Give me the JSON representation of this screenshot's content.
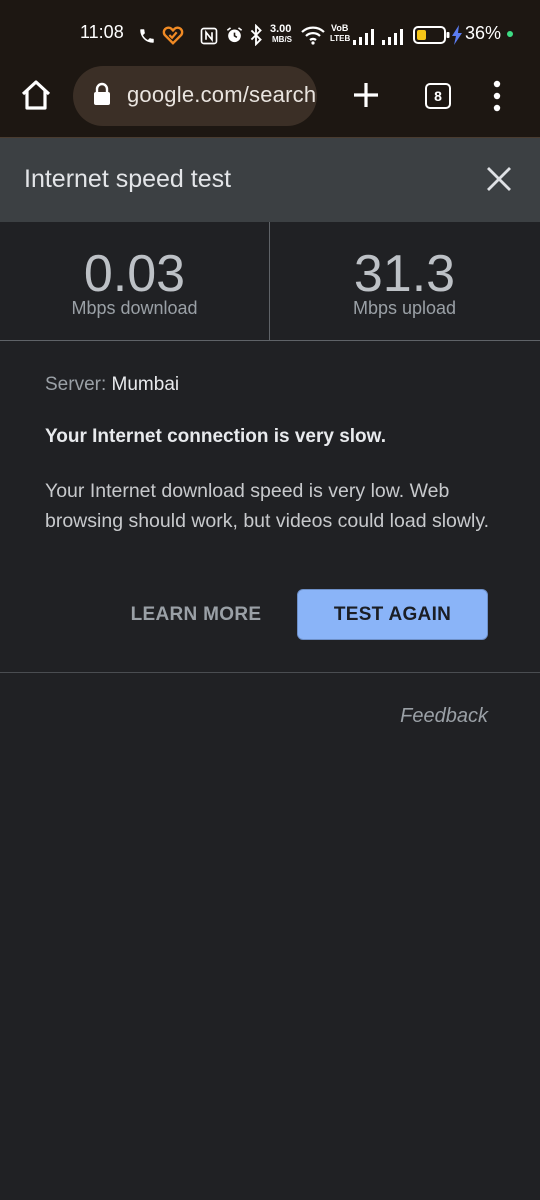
{
  "status_bar": {
    "time": "11:08",
    "net_speed_value": "3.00",
    "net_speed_unit": "MB/S",
    "volte_top": "VoB",
    "volte_bottom": "LTEB",
    "battery_percent": "36%",
    "battery_level": 0.36,
    "icons": [
      "phone-icon",
      "app-heart-icon",
      "nfc-icon",
      "alarm-icon",
      "bluetooth-icon",
      "wifi-icon",
      "signal-icon",
      "battery-icon",
      "charging-icon"
    ],
    "dot_color": "#3ddc84"
  },
  "toolbar": {
    "url": "google.com/search",
    "tab_count": "8",
    "icons": [
      "home-icon",
      "lock-icon",
      "plus-icon",
      "more-vert-icon"
    ]
  },
  "card": {
    "title": "Internet speed test",
    "download": {
      "value": "0.03",
      "label": "Mbps download"
    },
    "upload": {
      "value": "31.3",
      "label": "Mbps upload"
    },
    "server_label": "Server:",
    "server_value": "Mumbai",
    "headline": "Your Internet connection is very slow.",
    "description": "Your Internet download speed is very low. Web browsing should work, but videos could load slowly.",
    "learn_more": "LEARN MORE",
    "test_again": "TEST AGAIN",
    "feedback": "Feedback"
  },
  "colors": {
    "accent": "#8ab4f8",
    "battery_fill": "#f5c518",
    "charging": "#5b7cf0"
  }
}
